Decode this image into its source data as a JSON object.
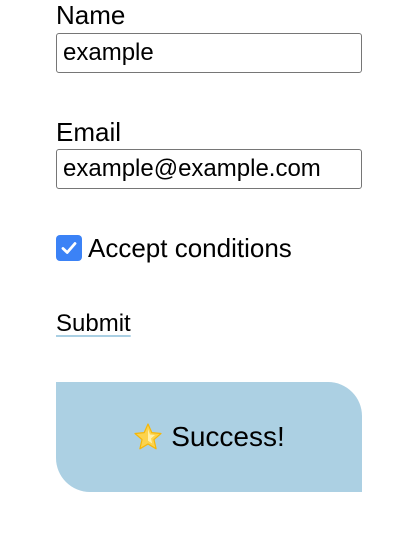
{
  "form": {
    "name_label": "Name",
    "name_value": "example",
    "email_label": "Email",
    "email_value": "example@example.com",
    "accept_label": "Accept conditions",
    "accept_checked": true,
    "submit_label": "Submit"
  },
  "result": {
    "message": "Success!",
    "icon": "star-icon"
  },
  "colors": {
    "checkbox": "#3b82f6",
    "success_background": "#acd0e3",
    "link_underline": "#a9cfe3"
  }
}
